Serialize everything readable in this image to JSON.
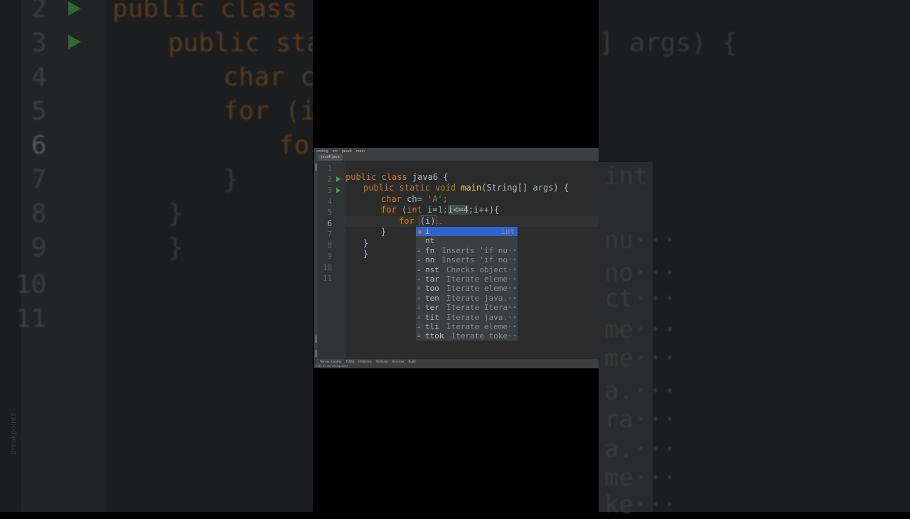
{
  "background": {
    "line_numbers": [
      "2",
      "3",
      "4",
      "5",
      "6",
      "7",
      "8",
      "9",
      "10",
      "11"
    ],
    "left_code": [
      "public class ja",
      "public sta",
      "char ch",
      "for (in",
      "fo",
      "}",
      "}",
      "}"
    ],
    "right_code": [
      "] args) {"
    ],
    "popup_fragments": [
      "int",
      "nu···",
      "no···",
      "ct···",
      "me···",
      "me···",
      "a.···",
      "ra···",
      "a.···",
      "me···",
      "ke···"
    ],
    "side_text": "Breakpoints"
  },
  "ide": {
    "breadcrumbs": [
      "coding",
      "src",
      "java6",
      "main"
    ],
    "tab_label": "java6.java",
    "gutter": {
      "line_numbers": [
        "1",
        "2",
        "3",
        "4",
        "5",
        "6",
        "7",
        "8",
        "9",
        "10",
        "11"
      ]
    },
    "code": {
      "line2_kw1": "public class",
      "line2_rest": " java6 {",
      "line3_kw": "public static void",
      "line3_fn": "main",
      "line3_rest": "(String[] args) {",
      "line4_kw": "char",
      "line4_mid": " ch= ",
      "line4_str": "'A'",
      "line4_end": ";",
      "line5_kw": "for",
      "line5_mid1": " (",
      "line5_kw2": "int",
      "line5_mid2": " i=",
      "line5_num1": "1",
      "line5_mid3": ";",
      "line5_cmp": "i<=4",
      "line5_mid4": ";i++){",
      "line6_kw": "for",
      "line6_typed": "(i)",
      "line7": "}",
      "line8": "}",
      "line9": "}"
    },
    "completion": {
      "items": [
        {
          "name": "i",
          "desc": "",
          "type": "int"
        },
        {
          "name": "nt",
          "desc": "",
          "type": ""
        },
        {
          "name": "fn",
          "desc": "Inserts 'if nu···",
          "type": ""
        },
        {
          "name": "nn",
          "desc": "Inserts 'if no···",
          "type": ""
        },
        {
          "name": "nst",
          "desc": "Checks object···",
          "type": ""
        },
        {
          "name": "tar",
          "desc": "Iterate eleme···",
          "type": ""
        },
        {
          "name": "too",
          "desc": "Iterate eleme···",
          "type": ""
        },
        {
          "name": "ten",
          "desc": "Iterate java.···",
          "type": ""
        },
        {
          "name": "ter",
          "desc": "Iterate Itera···",
          "type": ""
        },
        {
          "name": "tit",
          "desc": "Iterate java.···",
          "type": ""
        },
        {
          "name": "tli",
          "desc": "Iterate eleme···",
          "type": ""
        },
        {
          "name": "ttok",
          "desc": "Iterate toke···",
          "type": ""
        }
      ]
    },
    "bottom_tabs": [
      "Version Control",
      "TODO",
      "Problems",
      "Terminal",
      "Services",
      "Build"
    ],
    "status_text": "Indices are recognized"
  }
}
